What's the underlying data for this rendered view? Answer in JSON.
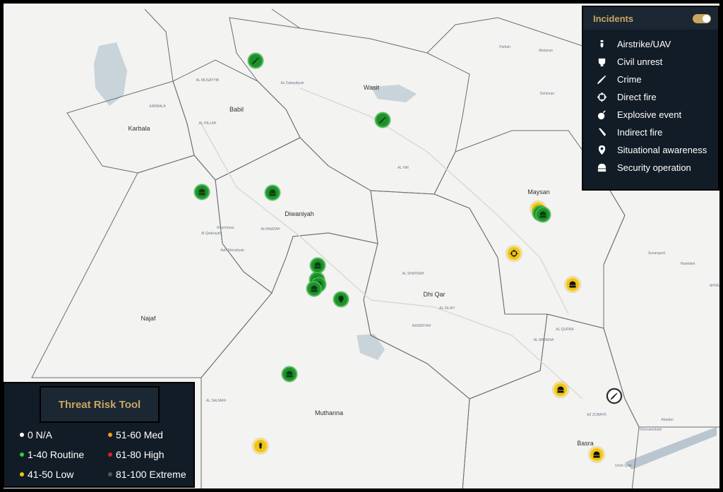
{
  "map": {
    "labels": [
      {
        "text": "Babil",
        "cls": "lbl"
      },
      {
        "text": "Karbala",
        "cls": "lbl"
      },
      {
        "text": "Wasit",
        "cls": "lbl"
      },
      {
        "text": "Diwaniyah",
        "cls": "lbl"
      },
      {
        "text": "Najaf",
        "cls": "lbl"
      },
      {
        "text": "Maysan",
        "cls": "lbl"
      },
      {
        "text": "Dhi Qar",
        "cls": "lbl"
      },
      {
        "text": "Muthanna",
        "cls": "lbl"
      },
      {
        "text": "Basra",
        "cls": "lbl"
      },
      {
        "text": "AL MUSAYYIB",
        "cls": "lbl sm"
      },
      {
        "text": "KARBALA",
        "cls": "lbl sm"
      },
      {
        "text": "AL HILLAH",
        "cls": "lbl sm"
      },
      {
        "text": "Az Zubaydiyah",
        "cls": "lbl sm"
      },
      {
        "text": "Pahlah",
        "cls": "lbl sm"
      },
      {
        "text": "Abdanan",
        "cls": "lbl sm"
      },
      {
        "text": "Dehloran",
        "cls": "lbl sm"
      },
      {
        "text": "AL HAI",
        "cls": "lbl sm"
      },
      {
        "text": "Gharmmas",
        "cls": "lbl sm"
      },
      {
        "text": "Al Qadisiyah",
        "cls": "lbl sm"
      },
      {
        "text": "ALHAMZAH",
        "cls": "lbl sm"
      },
      {
        "text": "Ash Shinafiyah",
        "cls": "lbl sm"
      },
      {
        "text": "AL SHATRAH",
        "cls": "lbl sm"
      },
      {
        "text": "AL ISLAH",
        "cls": "lbl sm"
      },
      {
        "text": "NASIRIYAH",
        "cls": "lbl sm"
      },
      {
        "text": "Susangerd",
        "cls": "lbl sm"
      },
      {
        "text": "Hamidieh",
        "cls": "lbl sm"
      },
      {
        "text": "AHVAZ",
        "cls": "lbl sm"
      },
      {
        "text": "AL QURNA",
        "cls": "lbl sm"
      },
      {
        "text": "AL-MIDAINA",
        "cls": "lbl sm"
      },
      {
        "text": "AL SALMAN",
        "cls": "lbl sm"
      },
      {
        "text": "AZ ZUBAYR",
        "cls": "lbl sm"
      },
      {
        "text": "Khorramshahr",
        "cls": "lbl sm"
      },
      {
        "text": "Abadan",
        "cls": "lbl sm"
      },
      {
        "text": "Umm Qasr",
        "cls": "lbl sm"
      }
    ],
    "markers": [
      {
        "name": "crime-marker",
        "color": "green",
        "icon": "crime"
      },
      {
        "name": "crime-marker",
        "color": "green",
        "icon": "crime"
      },
      {
        "name": "security-operation-marker",
        "color": "green",
        "icon": "security"
      },
      {
        "name": "security-operation-marker",
        "color": "green",
        "icon": "security"
      },
      {
        "name": "security-operation-marker",
        "color": "green",
        "icon": "security"
      },
      {
        "name": "security-operation-marker",
        "color": "green",
        "icon": "security"
      },
      {
        "name": "security-operation-marker",
        "color": "green",
        "icon": "security"
      },
      {
        "name": "security-operation-marker",
        "color": "green",
        "icon": "security"
      },
      {
        "name": "situational-awareness-marker",
        "color": "green",
        "icon": "situational"
      },
      {
        "name": "security-operation-marker",
        "color": "green",
        "icon": "security"
      },
      {
        "name": "security-operation-marker",
        "color": "yellow",
        "icon": "security"
      },
      {
        "name": "security-operation-marker",
        "color": "green",
        "icon": "security"
      },
      {
        "name": "security-operation-marker",
        "color": "green",
        "icon": "security"
      },
      {
        "name": "direct-fire-marker",
        "color": "yellow",
        "icon": "direct"
      },
      {
        "name": "security-operation-marker",
        "color": "yellow",
        "icon": "security"
      },
      {
        "name": "security-operation-marker",
        "color": "yellow",
        "icon": "security"
      },
      {
        "name": "crime-marker",
        "color": "white",
        "icon": "crime"
      },
      {
        "name": "airstrike-uav-marker",
        "color": "yellow",
        "icon": "airstrike"
      },
      {
        "name": "security-operation-marker",
        "color": "yellow",
        "icon": "security"
      }
    ]
  },
  "incidents": {
    "title": "Incidents",
    "toggle_on": true,
    "items": [
      {
        "label": "Airstrike/UAV",
        "icon": "airstrike-icon"
      },
      {
        "label": "Civil unrest",
        "icon": "civil-unrest-icon"
      },
      {
        "label": "Crime",
        "icon": "crime-icon"
      },
      {
        "label": "Direct fire",
        "icon": "direct-fire-icon"
      },
      {
        "label": "Explosive event",
        "icon": "explosive-icon"
      },
      {
        "label": "Indirect fire",
        "icon": "indirect-fire-icon"
      },
      {
        "label": "Situational awareness",
        "icon": "situational-awareness-icon"
      },
      {
        "label": "Security operation",
        "icon": "security-operation-icon"
      }
    ]
  },
  "threat": {
    "title": "Threat Risk Tool",
    "levels": [
      {
        "label": "0 N/A",
        "color": "#ffffff"
      },
      {
        "label": "51-60 Med",
        "color": "#f39c12"
      },
      {
        "label": "1-40 Routine",
        "color": "#2ecc40"
      },
      {
        "label": "61-80 High",
        "color": "#e02020"
      },
      {
        "label": "41-50 Low",
        "color": "#f1c40f"
      },
      {
        "label": "81-100 Extreme",
        "color": "#555555"
      }
    ]
  }
}
